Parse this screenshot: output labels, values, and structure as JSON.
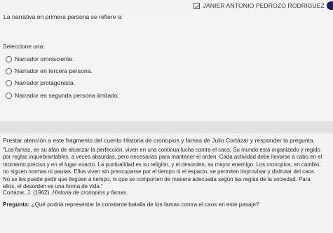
{
  "header": {
    "user_name": "JANIER ANTONIO PEDROZO RODRIGUEZ"
  },
  "question1": {
    "prompt": "La narrativa en primera persona se refiere a:",
    "select_label": "Seleccione una:",
    "options": [
      {
        "label": "Narrador omnisciente."
      },
      {
        "label": "Narrador en tercera persona."
      },
      {
        "label": "Narrador protagonista."
      },
      {
        "label": "Narrador en segunda persona limitado."
      }
    ]
  },
  "question2": {
    "instruction": "Prestar atención a este fragmento del cuento Historia de cronopios y famas de Julio Cortázar y responder la pregunta.",
    "passage_lines": [
      "\"Los famas, en su afán de alcanzar la perfección, viven en una continua lucha contra el caos. Su mundo está organizado y regido",
      "por reglas inquebrantables, a veces absurdas, pero necesarias para mantener el orden. Cada actividad debe llevarse a cabo en el",
      "momento preciso y en el lugar exacto. La puntualidad es su religión, y el desorden, su mayor enemigo. Los cronopios, en cambio,",
      "no siguen normas ni pautas. Ellos viven sin preocuparse por el tiempo ni el espacio, se permiten improvisar y disfrutar del caos.",
      "No se les puede pedir que lleguen a tiempo, ni que se comporten de manera adecuada según las reglas de la sociedad. Para",
      "ellos, el desorden es una forma de vida.\""
    ],
    "citation_author": "Cortázar, J. (1962).",
    "citation_title": "Historia de cronopios y famas.",
    "question_label": "Pregunta:",
    "question_text": "¿Qué podría representar la constante batalla de los famas contra el caos en este pasaje?"
  }
}
